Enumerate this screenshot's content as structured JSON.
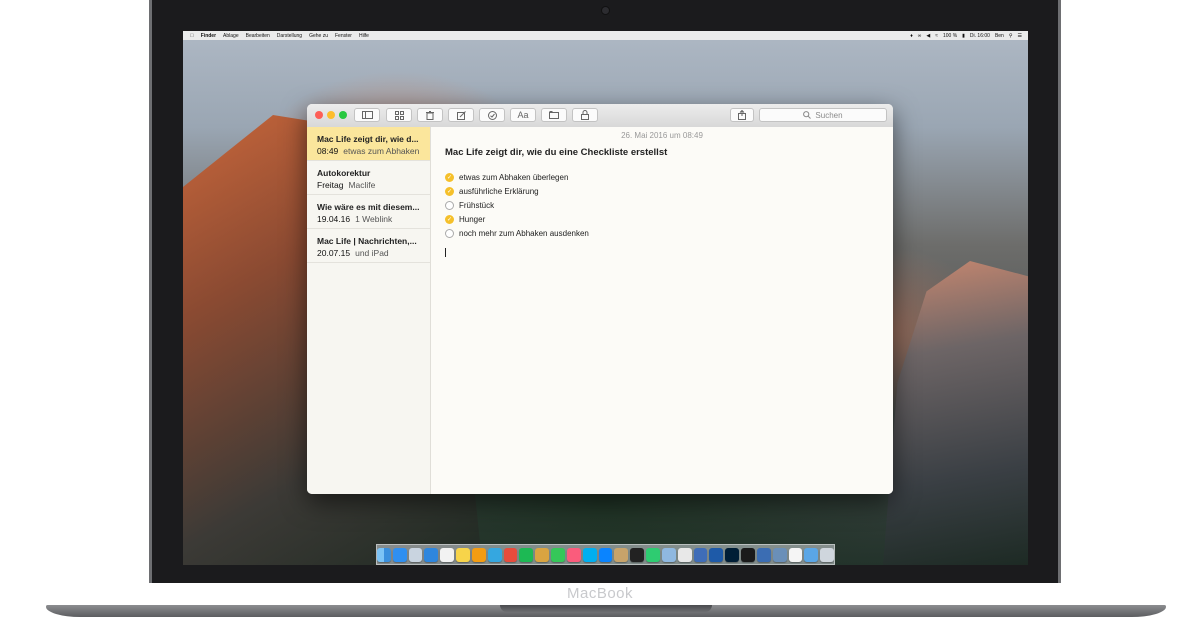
{
  "device": {
    "label": "MacBook"
  },
  "menubar": {
    "items": [
      "Finder",
      "Ablage",
      "Bearbeiten",
      "Darstellung",
      "Gehe zu",
      "Fenster",
      "Hilfe"
    ],
    "battery": "100 %",
    "clock": "Di. 16:00",
    "user": "Ben"
  },
  "toolbar": {
    "search_placeholder": "Suchen",
    "font_label": "Aa"
  },
  "notes": [
    {
      "title": "Mac Life zeigt dir, wie d...",
      "date": "08:49",
      "snippet": "etwas zum Abhaken...",
      "selected": true
    },
    {
      "title": "Autokorektur",
      "date": "Freitag",
      "snippet": "Maclife",
      "selected": false
    },
    {
      "title": "Wie wäre es mit diesem...",
      "date": "19.04.16",
      "snippet": "1 Weblink",
      "selected": false
    },
    {
      "title": "Mac Life | Nachrichten,...",
      "date": "20.07.15",
      "snippet": "und iPad",
      "selected": false
    }
  ],
  "editor": {
    "date": "26. Mai 2016 um 08:49",
    "title": "Mac Life zeigt dir, wie du eine Checkliste erstellst",
    "checklist": [
      {
        "text": "etwas zum Abhaken überlegen",
        "checked": true
      },
      {
        "text": "ausführliche Erklärung",
        "checked": true
      },
      {
        "text": "Frühstück",
        "checked": false
      },
      {
        "text": "Hunger",
        "checked": true
      },
      {
        "text": "noch mehr zum Abhaken ausdenken",
        "checked": false
      }
    ]
  },
  "colors": {
    "accent_yellow": "#f5c02b",
    "selected_note": "#fbe69c"
  },
  "dock_icons": [
    "finder-icon",
    "appstore-icon",
    "preview-icon",
    "safari-icon",
    "calendar-icon",
    "notes-icon",
    "pages-icon",
    "telegram-icon",
    "chrome-icon",
    "spotify-icon",
    "ibooks-icon",
    "messages-icon",
    "itunes-icon",
    "skype-icon",
    "shazam-icon",
    "scrivener-icon",
    "stocks-icon",
    "numbers-icon",
    "preview2-icon",
    "photos-icon",
    "vectorize-icon",
    "app-icon",
    "photoshop-icon",
    "sonos-icon",
    "network-icon",
    "screenshot-icon",
    "textedit-icon",
    "folder-icon",
    "trash-icon"
  ]
}
